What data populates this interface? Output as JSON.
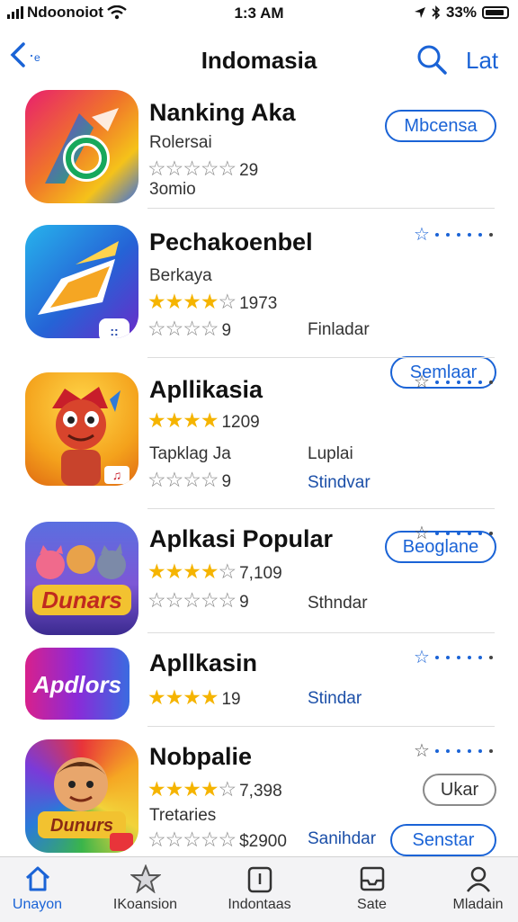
{
  "status_bar": {
    "carrier": "Ndoonoiot",
    "time": "1:3 AM",
    "battery": "33%"
  },
  "nav": {
    "back_icon": "chevron-left-icon",
    "title": "Indomasia",
    "search_icon": "search-icon",
    "action_label": "Lat"
  },
  "colors": {
    "accent": "#1a63d6",
    "star": "#f5b400"
  },
  "apps": [
    {
      "name": "Nanking Aka",
      "subtitle": "Rolersai",
      "rating_count": "29",
      "extra": "3omio",
      "button": "Mbcensa"
    },
    {
      "name": "Pechakoenbel",
      "subtitle": "Berkaya",
      "rating_count": "1973",
      "rating_count_2": "9",
      "meta": "Finladar",
      "button": "Semlaar"
    },
    {
      "name": "Apllikasia",
      "rating_count": "1209",
      "subtitle": "Tapklag Ja",
      "rating_count_2": "9",
      "meta_label": "Luplai",
      "meta": "Stindvar",
      "button": "Beoglane"
    },
    {
      "name": "Aplkasi Popular",
      "rating_count": "7,109",
      "rating_count_2": "9",
      "meta": "Sthndar",
      "icon_text": "Dunars"
    },
    {
      "name": "Apllkasin",
      "rating_count": "19",
      "meta": "Stindar",
      "icon_text": "Apdlors"
    },
    {
      "name": "Nobpalie",
      "rating_count": "7,398",
      "subtitle": "Tretaries",
      "price": "$2900",
      "meta": "Sanihdar",
      "button": "Ukar",
      "button_2": "Senstar",
      "icon_text": "Dunurs"
    }
  ],
  "tabs": [
    {
      "label": "Unayon",
      "icon": "home-icon"
    },
    {
      "label": "IKoansion",
      "icon": "star-icon"
    },
    {
      "label": "Indontaas",
      "icon": "card-icon"
    },
    {
      "label": "Sate",
      "icon": "inbox-icon"
    },
    {
      "label": "Mladain",
      "icon": "person-icon"
    }
  ]
}
